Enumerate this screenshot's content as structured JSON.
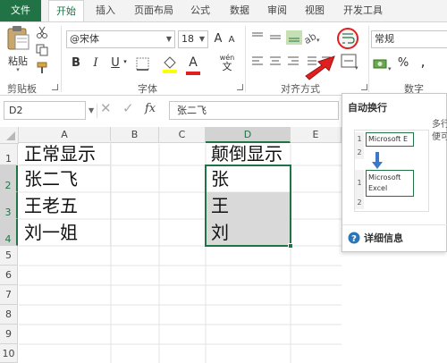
{
  "tabs": [
    "文件",
    "开始",
    "插入",
    "页面布局",
    "公式",
    "数据",
    "审阅",
    "视图",
    "开发工具"
  ],
  "ribbon": {
    "clipboard": {
      "paste_label": "粘贴",
      "group_label": "剪贴板"
    },
    "font": {
      "name": "@宋体",
      "size": "18",
      "grow_label": "A",
      "shrink_label": "A",
      "bold_label": "B",
      "italic_label": "I",
      "underline_label": "U",
      "font_color_label": "A",
      "wen_label": "wén",
      "group_label": "字体"
    },
    "alignment": {
      "group_label": "对齐方式"
    },
    "number": {
      "format": "常规",
      "percent_label": "%",
      "comma_label": ",",
      "group_label": "数字"
    }
  },
  "formula_bar": {
    "name_box": "D2",
    "fx_label": "fx",
    "value": "张二飞"
  },
  "grid": {
    "columns": [
      "A",
      "B",
      "C",
      "D",
      "E"
    ],
    "rows": [
      "1",
      "2",
      "3",
      "4",
      "5",
      "6",
      "7",
      "8",
      "9",
      "10"
    ],
    "cells": {
      "A1": "正常显示",
      "A2": "张二飞",
      "A3": "王老五",
      "A4": "刘一姐",
      "D1": "颠倒显示",
      "D2": "张",
      "D3": "王",
      "D4": "刘"
    }
  },
  "tooltip": {
    "title": "自动换行",
    "desc": "多行\n便可",
    "example_before": "Microsoft E",
    "example_after_line1": "Microsoft",
    "example_after_line2": "Excel",
    "example_row1": "1",
    "example_row2": "2",
    "more_info": "详细信息"
  },
  "colors": {
    "accent": "#217346",
    "annotation": "#e02020",
    "selection_fill": "#d9d9d9"
  },
  "icons": [
    "clipboard-icon",
    "cut-icon",
    "copy-icon",
    "format-painter-icon",
    "wrap-text-icon",
    "help-icon"
  ]
}
